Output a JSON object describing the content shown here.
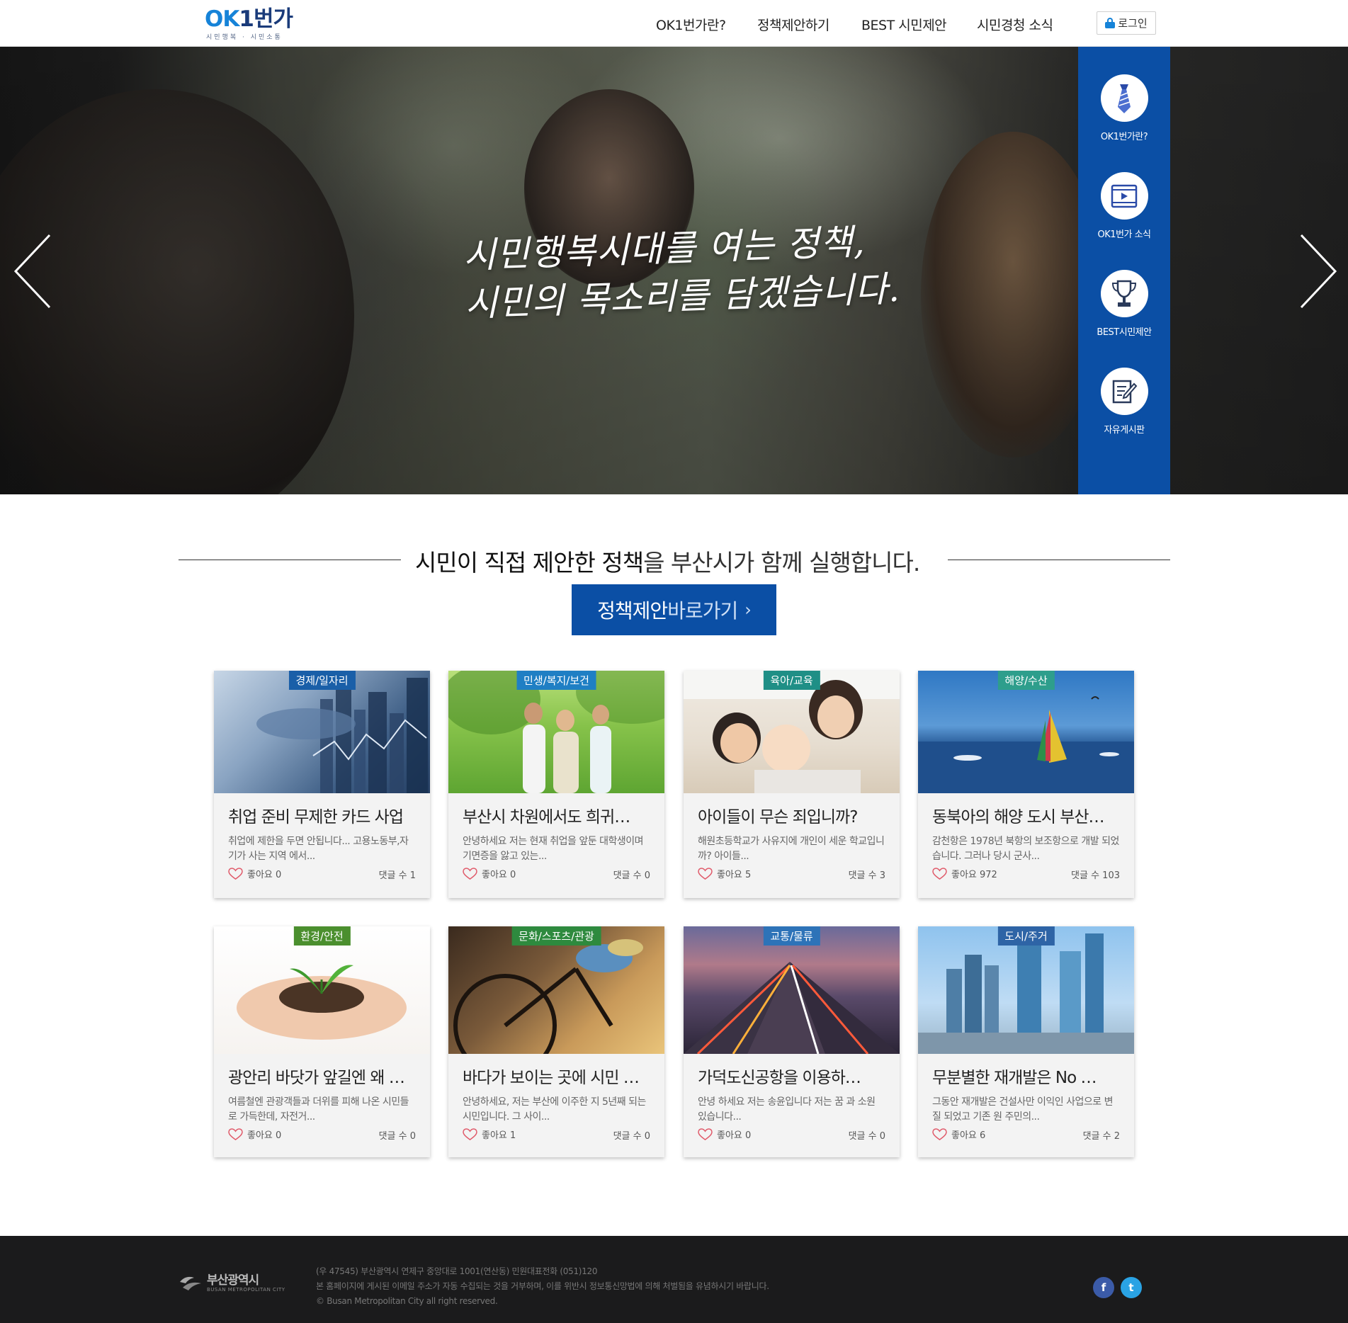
{
  "header": {
    "logo_text_ok": "OK",
    "logo_text_rest": "1번가",
    "logo_sub": "시민행복 · 시민소통",
    "nav": [
      "OK1번가란?",
      "정책제안하기",
      "BEST 시민제안",
      "시민경청 소식"
    ],
    "login_label": "로그인"
  },
  "hero": {
    "headline_line1": "시민행복시대를 여는 정책,",
    "headline_line2": "시민의 목소리를 담겠습니다.",
    "quick_menu": [
      {
        "label": "OK1번가란?",
        "icon": "necktie-icon"
      },
      {
        "label": "OK1번가 소식",
        "icon": "video-icon"
      },
      {
        "label": "BEST시민제안",
        "icon": "trophy-icon"
      },
      {
        "label": "자유게시판",
        "icon": "edit-note-icon"
      }
    ]
  },
  "section": {
    "title_strong": "시민이 직접 제안한 정책",
    "title_rest": "을 부산시가 함께 실행합니다."
  },
  "cta": {
    "strong": "정책제안",
    "light": "바로가기",
    "arrow": "›"
  },
  "cards": [
    {
      "tag": "경제/일자리",
      "tag_color": "#1a5fa8",
      "title": "취업 준비 무제한 카드 사업",
      "desc": "취업에 제한을 두면 안됩니다... 고용노동부,자기가 사는 지역 에서...",
      "likes": "좋아요 0",
      "comments": "댓글 수 1"
    },
    {
      "tag": "민생/복지/보건",
      "tag_color": "#1f7fc4",
      "title": "부산시 차원에서도 희귀…",
      "desc": "안녕하세요 저는 현재 취업을 앞둔 대학생이며 기면증을 앓고 있는...",
      "likes": "좋아요 0",
      "comments": "댓글 수 0"
    },
    {
      "tag": "육아/교육",
      "tag_color": "#1f8f86",
      "title": "아이들이 무슨 죄입니까?",
      "desc": "해원초등학교가 사유지에 개인이 세운 학교입니까? 아이들...",
      "likes": "좋아요 5",
      "comments": "댓글 수 3"
    },
    {
      "tag": "해양/수산",
      "tag_color": "#2e9e8c",
      "title": "동북아의 해양 도시 부산…",
      "desc": "감천항은 1978년 북항의 보조항으로 개발 되었습니다. 그러나 당시 군사...",
      "likes": "좋아요 972",
      "comments": "댓글 수 103"
    },
    {
      "tag": "환경/안전",
      "tag_color": "#4b8f2e",
      "title": "광안리 바닷가 앞길엔 왜 …",
      "desc": "여름철엔 관광객들과 더위를 피해 나온 시민들로 가득한데, 자전거...",
      "likes": "좋아요 0",
      "comments": "댓글 수 0"
    },
    {
      "tag": "문화/스포츠/관광",
      "tag_color": "#2e8a3e",
      "title": "바다가 보이는 곳에 시민 …",
      "desc": "안녕하세요, 저는 부산에 이주한 지 5년째 되는 시민입니다. 그 사이...",
      "likes": "좋아요 1",
      "comments": "댓글 수 0"
    },
    {
      "tag": "교통/물류",
      "tag_color": "#2d73b8",
      "title": "가덕도신공항을 이용하…",
      "desc": "안녕 하세요 저는 송윤입니다 저는 꿈 과 소원 있습니다...",
      "likes": "좋아요 0",
      "comments": "댓글 수 0"
    },
    {
      "tag": "도시/주거",
      "tag_color": "#2e64a6",
      "title": "무분별한 재개발은 No …",
      "desc": "그동안 재개발은 건설사만 이익인 사업으로 변질 되었고 기존 원 주민의...",
      "likes": "좋아요 6",
      "comments": "댓글 수 2"
    }
  ],
  "footer": {
    "logo_text": "부산광역시",
    "logo_sub": "BUSAN METROPOLITAN CITY",
    "address": "(우 47545) 부산광역시 연제구 중앙대로 1001(연산동) 민원대표전화 (051)120",
    "notice": "본 홈페이지에 게시된 이메일 주소가 자동 수집되는 것을 거부하며, 이를 위반시 정보통신망법에 의해 처벌됨을 유념하시기 바랍니다.",
    "copyright": "© Busan Metropolitan City all right reserved.",
    "facebook_label": "f",
    "twitter_label": "t"
  },
  "colors": {
    "brand_blue": "#0b4fa5",
    "logo_light_blue": "#1683d8",
    "footer_bg": "#1b1b1c",
    "heart": "#e05a6a"
  }
}
